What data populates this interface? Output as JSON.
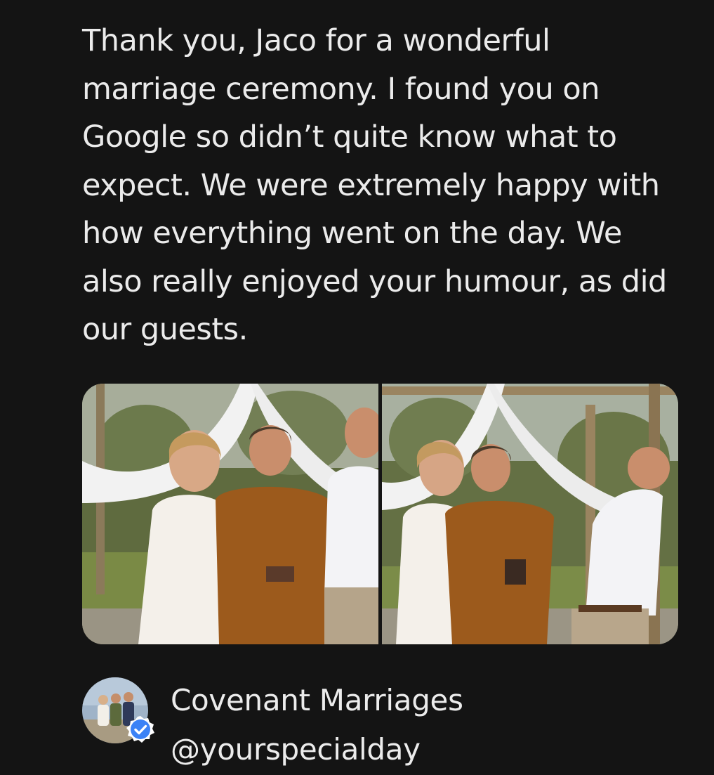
{
  "review": {
    "lines": [
      "Thank you, Jaco for a wonderful",
      "marriage ceremony. I found you on",
      "Google so didn’t quite know what to",
      "expect. We were extremely happy with",
      "how everything went on the day. We",
      "also really enjoyed your humour, as did",
      "our guests."
    ]
  },
  "photos": [
    {
      "icon": "wedding-photo-couple-smiling"
    },
    {
      "icon": "wedding-photo-groom-laughing"
    }
  ],
  "author": {
    "name": "Covenant Marriages",
    "handle": "@yourspecialday",
    "verified_icon": "verified-badge-icon",
    "badge_color": "#3b82f6"
  }
}
